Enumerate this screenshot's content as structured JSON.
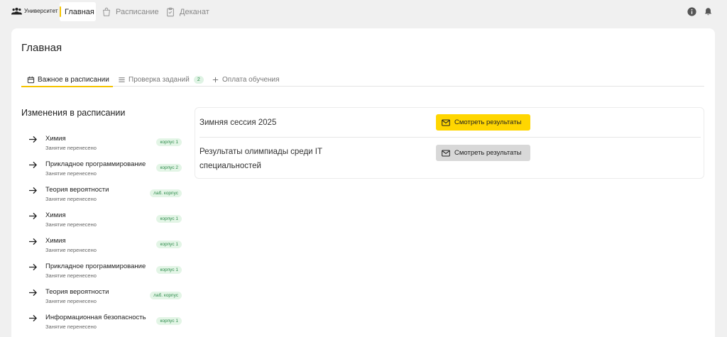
{
  "colors": {
    "accent": "#f5c400",
    "button_primary": "#ffd600",
    "tag_bg": "#e3f5e6",
    "tag_text": "#2c8a4a"
  },
  "topnav": {
    "logo_icon": "users-icon",
    "logo_text": "Университет",
    "items": [
      {
        "label": "Главная",
        "icon": "none",
        "active": true
      },
      {
        "label": "Расписание",
        "icon": "bag-icon"
      },
      {
        "label": "Деканат",
        "icon": "clipboard-icon"
      }
    ],
    "right_icons": [
      "info-icon",
      "bell-icon"
    ]
  },
  "page": {
    "title": "Главная"
  },
  "tabs": [
    {
      "label": "Важное в расписании",
      "icon": "calendar-icon",
      "active": true
    },
    {
      "label": "Проверка заданий",
      "icon": "list-icon",
      "count": "2"
    },
    {
      "label": "Оплата обучения",
      "icon": "plus-icon"
    }
  ],
  "schedule_changes": {
    "title": "Изменения в расписании",
    "items": [
      {
        "subject": "Химия",
        "status": "Занятие перенесено",
        "tag": "корпус 1"
      },
      {
        "subject": "Прикладное программирование",
        "status": "Занятие перенесено",
        "tag": "корпус 2"
      },
      {
        "subject": "Теория вероятности",
        "status": "Занятие перенесено",
        "tag": "лаб. корпус"
      },
      {
        "subject": "Химия",
        "status": "Занятие перенесено",
        "tag": "корпус 1"
      },
      {
        "subject": "Химия",
        "status": "Занятие перенесено",
        "tag": "корпус 1"
      },
      {
        "subject": "Прикладное программирование",
        "status": "Занятие перенесено",
        "tag": "корпус 1"
      },
      {
        "subject": "Теория вероятности",
        "status": "Занятие перенесено",
        "tag": "лаб. корпус"
      },
      {
        "subject": "Информационная безопасность",
        "status": "Занятие перенесено",
        "tag": "корпус 1"
      }
    ]
  },
  "results": [
    {
      "label": "Зимняя сессия 2025",
      "button": "Смотреть результаты",
      "button_style": "primary"
    },
    {
      "label": "Результаты олимпиады среди IT специальностей",
      "button": "Смотреть результаты",
      "button_style": "secondary"
    }
  ]
}
